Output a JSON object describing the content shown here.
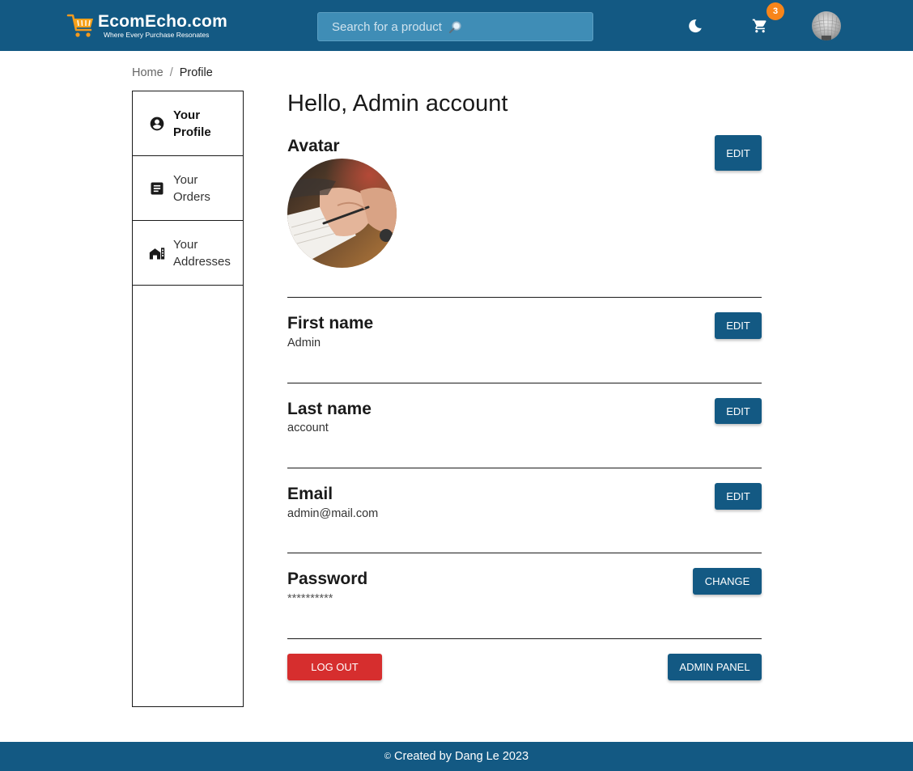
{
  "header": {
    "logo_title": "EcomEcho.com",
    "logo_tagline": "Where Every Purchase Resonates",
    "search_placeholder": "Search for a product",
    "cart_count": "3",
    "icons": [
      "cart-logo-icon",
      "search-icon",
      "moon-icon",
      "shopping-cart-icon",
      "user-avatar"
    ],
    "colors": {
      "primary": "#135983",
      "badge": "#f7851a",
      "danger": "#d62e2e"
    }
  },
  "breadcrumb": {
    "home": "Home",
    "separator": "/",
    "current": "Profile"
  },
  "sidebar": {
    "items": [
      {
        "line1": "Your",
        "line2": "Profile",
        "icon": "account-circle-icon",
        "active": true
      },
      {
        "line1": "Your",
        "line2": "Orders",
        "icon": "receipt-icon",
        "active": false
      },
      {
        "line1": "Your",
        "line2": "Addresses",
        "icon": "house-icon",
        "active": false
      }
    ]
  },
  "main": {
    "greeting": "Hello, Admin account",
    "avatar": {
      "title": "Avatar",
      "button": "EDIT"
    },
    "first_name": {
      "title": "First name",
      "value": "Admin",
      "button": "EDIT"
    },
    "last_name": {
      "title": "Last name",
      "value": "account",
      "button": "EDIT"
    },
    "email": {
      "title": "Email",
      "value": "admin@mail.com",
      "button": "EDIT"
    },
    "password": {
      "title": "Password",
      "value": "**********",
      "button": "CHANGE"
    },
    "logout_button": "LOG OUT",
    "admin_button": "ADMIN PANEL"
  },
  "footer": {
    "copyright_symbol": "©",
    "text": "Created by Dang Le 2023"
  }
}
